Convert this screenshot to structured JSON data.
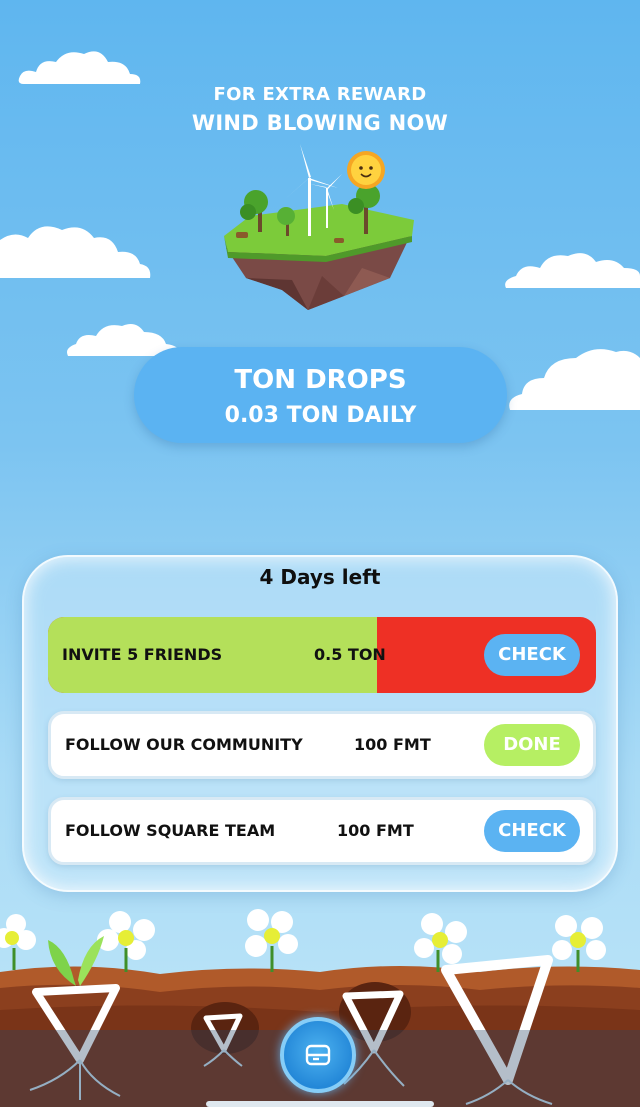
{
  "header": {
    "line1": "FOR EXTRA REWARD",
    "line2": "WIND BLOWING NOW",
    "illustration": "floating-island-wind-turbines"
  },
  "ton_drops": {
    "title": "TON DROPS",
    "subtitle": "0.03 TON DAILY"
  },
  "tasks": {
    "days_left": "4 Days left",
    "items": [
      {
        "title": "INVITE 5 FRIENDS",
        "reward": "0.5 TON",
        "button": "CHECK",
        "progress": 0.6
      },
      {
        "title": "FOLLOW OUR COMMUNITY",
        "reward": "100 FMT",
        "button": "DONE"
      },
      {
        "title": "FOLLOW SQUARE TEAM",
        "reward": "100 FMT",
        "button": "CHECK"
      }
    ]
  },
  "bottom_nav": {
    "center_icon": "card-icon"
  },
  "colors": {
    "sky": "#5fb6ef",
    "accent_blue": "#5bb3f2",
    "progress_green": "#b4e05a",
    "remaining_red": "#ee3025",
    "done_green": "#b6ef63",
    "soil": "#8b3f1e"
  }
}
